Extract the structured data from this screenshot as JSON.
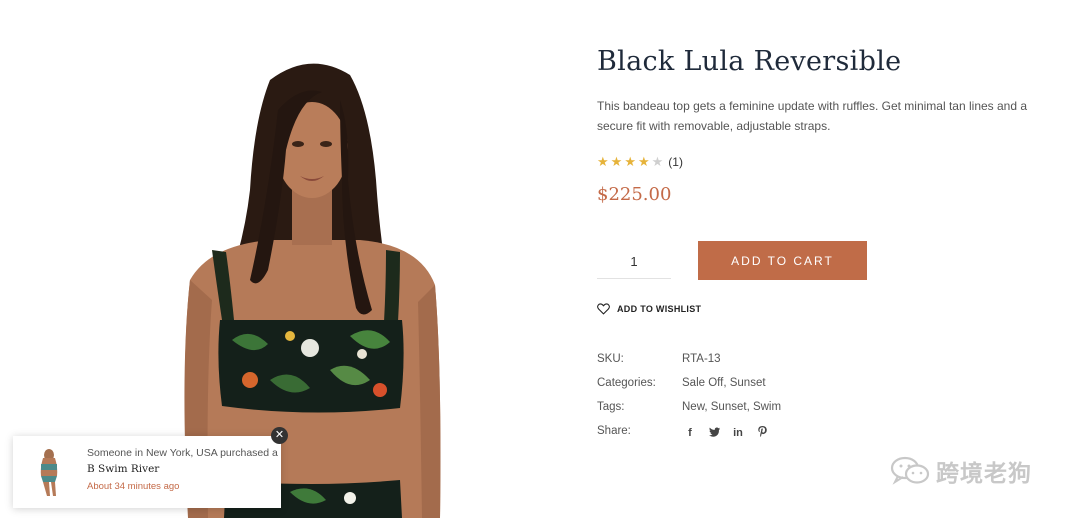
{
  "product": {
    "title": "Black Lula Reversible",
    "description": "This bandeau top gets a feminine update with ruffles. Get minimal tan lines and a secure fit with removable, adjustable straps.",
    "rating": 4,
    "rating_max": 5,
    "review_count": "(1)",
    "price": "$225.00",
    "quantity": "1",
    "add_to_cart_label": "ADD TO CART",
    "wishlist_label": "ADD TO WISHLIST",
    "image_icon": "product-photo-swimwear-model"
  },
  "meta": {
    "sku_label": "SKU:",
    "sku_value": "RTA-13",
    "categories_label": "Categories:",
    "categories_value": "Sale Off, Sunset",
    "tags_label": "Tags:",
    "tags_value": "New, Sunset, Swim",
    "share_label": "Share:",
    "share_icons": [
      "facebook-icon",
      "twitter-icon",
      "linkedin-icon",
      "pinterest-icon"
    ]
  },
  "popup": {
    "line1": "Someone in New York, USA purchased a",
    "product": "B Swim River",
    "time": "About 34 minutes ago",
    "close_icon": "close-icon"
  },
  "watermark": {
    "text": "跨境老狗",
    "icon": "wechat-icon"
  },
  "colors": {
    "accent": "#c06c48",
    "price": "#c46a48",
    "title": "#1f2a3a",
    "star": "#e6b33a",
    "star_empty": "#cfcfcf"
  }
}
